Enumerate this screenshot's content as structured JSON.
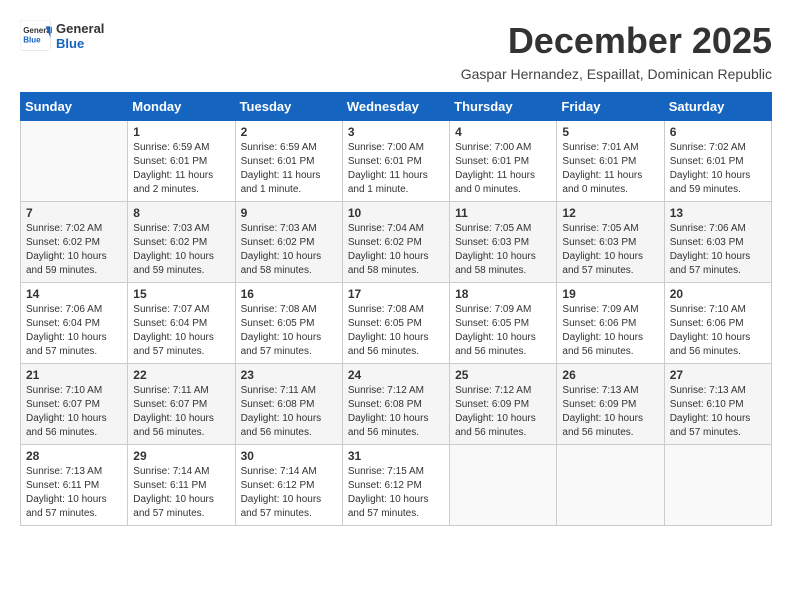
{
  "logo": {
    "name_general": "General",
    "name_blue": "Blue"
  },
  "title": "December 2025",
  "subtitle": "Gaspar Hernandez, Espaillat, Dominican Republic",
  "days_of_week": [
    "Sunday",
    "Monday",
    "Tuesday",
    "Wednesday",
    "Thursday",
    "Friday",
    "Saturday"
  ],
  "weeks": [
    [
      {
        "day": "",
        "info": ""
      },
      {
        "day": "1",
        "info": "Sunrise: 6:59 AM\nSunset: 6:01 PM\nDaylight: 11 hours\nand 2 minutes."
      },
      {
        "day": "2",
        "info": "Sunrise: 6:59 AM\nSunset: 6:01 PM\nDaylight: 11 hours\nand 1 minute."
      },
      {
        "day": "3",
        "info": "Sunrise: 7:00 AM\nSunset: 6:01 PM\nDaylight: 11 hours\nand 1 minute."
      },
      {
        "day": "4",
        "info": "Sunrise: 7:00 AM\nSunset: 6:01 PM\nDaylight: 11 hours\nand 0 minutes."
      },
      {
        "day": "5",
        "info": "Sunrise: 7:01 AM\nSunset: 6:01 PM\nDaylight: 11 hours\nand 0 minutes."
      },
      {
        "day": "6",
        "info": "Sunrise: 7:02 AM\nSunset: 6:01 PM\nDaylight: 10 hours\nand 59 minutes."
      }
    ],
    [
      {
        "day": "7",
        "info": "Sunrise: 7:02 AM\nSunset: 6:02 PM\nDaylight: 10 hours\nand 59 minutes."
      },
      {
        "day": "8",
        "info": "Sunrise: 7:03 AM\nSunset: 6:02 PM\nDaylight: 10 hours\nand 59 minutes."
      },
      {
        "day": "9",
        "info": "Sunrise: 7:03 AM\nSunset: 6:02 PM\nDaylight: 10 hours\nand 58 minutes."
      },
      {
        "day": "10",
        "info": "Sunrise: 7:04 AM\nSunset: 6:02 PM\nDaylight: 10 hours\nand 58 minutes."
      },
      {
        "day": "11",
        "info": "Sunrise: 7:05 AM\nSunset: 6:03 PM\nDaylight: 10 hours\nand 58 minutes."
      },
      {
        "day": "12",
        "info": "Sunrise: 7:05 AM\nSunset: 6:03 PM\nDaylight: 10 hours\nand 57 minutes."
      },
      {
        "day": "13",
        "info": "Sunrise: 7:06 AM\nSunset: 6:03 PM\nDaylight: 10 hours\nand 57 minutes."
      }
    ],
    [
      {
        "day": "14",
        "info": "Sunrise: 7:06 AM\nSunset: 6:04 PM\nDaylight: 10 hours\nand 57 minutes."
      },
      {
        "day": "15",
        "info": "Sunrise: 7:07 AM\nSunset: 6:04 PM\nDaylight: 10 hours\nand 57 minutes."
      },
      {
        "day": "16",
        "info": "Sunrise: 7:08 AM\nSunset: 6:05 PM\nDaylight: 10 hours\nand 57 minutes."
      },
      {
        "day": "17",
        "info": "Sunrise: 7:08 AM\nSunset: 6:05 PM\nDaylight: 10 hours\nand 56 minutes."
      },
      {
        "day": "18",
        "info": "Sunrise: 7:09 AM\nSunset: 6:05 PM\nDaylight: 10 hours\nand 56 minutes."
      },
      {
        "day": "19",
        "info": "Sunrise: 7:09 AM\nSunset: 6:06 PM\nDaylight: 10 hours\nand 56 minutes."
      },
      {
        "day": "20",
        "info": "Sunrise: 7:10 AM\nSunset: 6:06 PM\nDaylight: 10 hours\nand 56 minutes."
      }
    ],
    [
      {
        "day": "21",
        "info": "Sunrise: 7:10 AM\nSunset: 6:07 PM\nDaylight: 10 hours\nand 56 minutes."
      },
      {
        "day": "22",
        "info": "Sunrise: 7:11 AM\nSunset: 6:07 PM\nDaylight: 10 hours\nand 56 minutes."
      },
      {
        "day": "23",
        "info": "Sunrise: 7:11 AM\nSunset: 6:08 PM\nDaylight: 10 hours\nand 56 minutes."
      },
      {
        "day": "24",
        "info": "Sunrise: 7:12 AM\nSunset: 6:08 PM\nDaylight: 10 hours\nand 56 minutes."
      },
      {
        "day": "25",
        "info": "Sunrise: 7:12 AM\nSunset: 6:09 PM\nDaylight: 10 hours\nand 56 minutes."
      },
      {
        "day": "26",
        "info": "Sunrise: 7:13 AM\nSunset: 6:09 PM\nDaylight: 10 hours\nand 56 minutes."
      },
      {
        "day": "27",
        "info": "Sunrise: 7:13 AM\nSunset: 6:10 PM\nDaylight: 10 hours\nand 57 minutes."
      }
    ],
    [
      {
        "day": "28",
        "info": "Sunrise: 7:13 AM\nSunset: 6:11 PM\nDaylight: 10 hours\nand 57 minutes."
      },
      {
        "day": "29",
        "info": "Sunrise: 7:14 AM\nSunset: 6:11 PM\nDaylight: 10 hours\nand 57 minutes."
      },
      {
        "day": "30",
        "info": "Sunrise: 7:14 AM\nSunset: 6:12 PM\nDaylight: 10 hours\nand 57 minutes."
      },
      {
        "day": "31",
        "info": "Sunrise: 7:15 AM\nSunset: 6:12 PM\nDaylight: 10 hours\nand 57 minutes."
      },
      {
        "day": "",
        "info": ""
      },
      {
        "day": "",
        "info": ""
      },
      {
        "day": "",
        "info": ""
      }
    ]
  ]
}
